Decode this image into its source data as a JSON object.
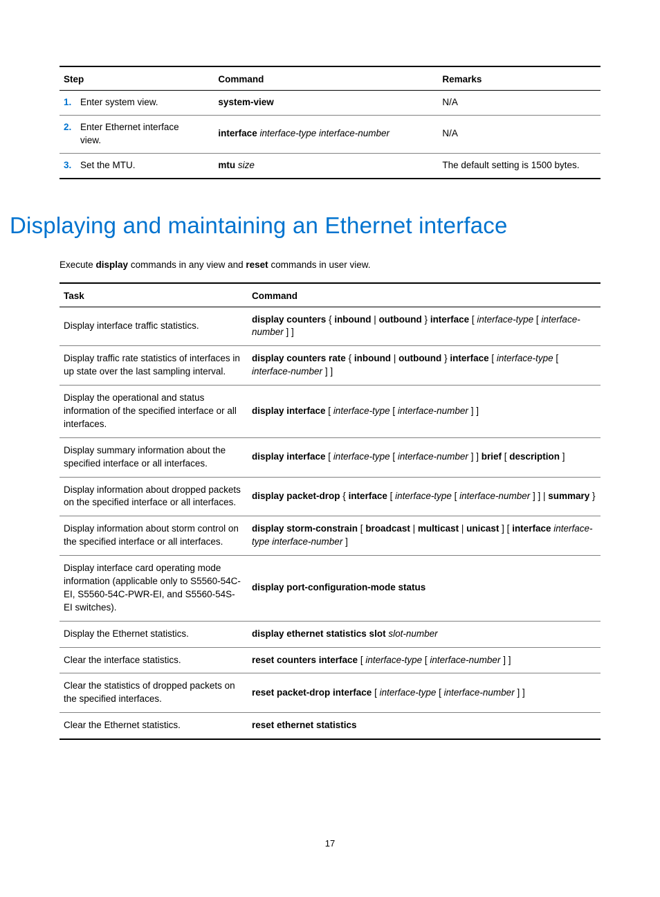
{
  "steps_table": {
    "headers": {
      "step": "Step",
      "command": "Command",
      "remarks": "Remarks"
    },
    "rows": [
      {
        "num": "1.",
        "step": "Enter system view.",
        "cmd_bold": "system-view",
        "cmd_italic": "",
        "remarks": "N/A"
      },
      {
        "num": "2.",
        "step": "Enter Ethernet interface view.",
        "cmd_bold": "interface",
        "cmd_italic": " interface-type interface-number",
        "remarks": "N/A"
      },
      {
        "num": "3.",
        "step": "Set the MTU.",
        "cmd_bold": "mtu",
        "cmd_italic": " size",
        "remarks": "The default setting is 1500 bytes."
      }
    ]
  },
  "heading": "Displaying and maintaining an Ethernet interface",
  "intro": {
    "p1": "Execute ",
    "b1": "display",
    "p2": " commands in any view and ",
    "b2": "reset",
    "p3": " commands in user view."
  },
  "tasks_table": {
    "headers": {
      "task": "Task",
      "command": "Command"
    },
    "rows": [
      {
        "task": "Display interface traffic statistics.",
        "cmd": [
          {
            "b": "display counters"
          },
          {
            "t": " { "
          },
          {
            "b": "inbound"
          },
          {
            "t": " | "
          },
          {
            "b": "outbound"
          },
          {
            "t": " } "
          },
          {
            "b": "interface"
          },
          {
            "t": " [ "
          },
          {
            "i": "interface-type"
          },
          {
            "t": " [ "
          },
          {
            "i": "interface-number"
          },
          {
            "t": " ] ]"
          }
        ]
      },
      {
        "task": "Display traffic rate statistics of interfaces in up state over the last sampling interval.",
        "cmd": [
          {
            "b": "display counters rate"
          },
          {
            "t": " { "
          },
          {
            "b": "inbound"
          },
          {
            "t": " | "
          },
          {
            "b": "outbound"
          },
          {
            "t": " } "
          },
          {
            "b": "interface"
          },
          {
            "t": " [ "
          },
          {
            "i": "interface-type"
          },
          {
            "t": " [ "
          },
          {
            "i": "interface-number"
          },
          {
            "t": " ] ]"
          }
        ]
      },
      {
        "task": "Display the operational and status information of the specified interface or all interfaces.",
        "cmd": [
          {
            "b": "display interface"
          },
          {
            "t": " [ "
          },
          {
            "i": "interface-type"
          },
          {
            "t": " [ "
          },
          {
            "i": "interface-number"
          },
          {
            "t": " ] ]"
          }
        ]
      },
      {
        "task": "Display summary information about the specified interface or all interfaces.",
        "cmd": [
          {
            "b": "display interface"
          },
          {
            "t": " [ "
          },
          {
            "i": "interface-type"
          },
          {
            "t": " [ "
          },
          {
            "i": "interface-number"
          },
          {
            "t": " ] ] "
          },
          {
            "b": "brief"
          },
          {
            "t": " [ "
          },
          {
            "b": "description"
          },
          {
            "t": " ]"
          }
        ]
      },
      {
        "task": "Display information about dropped packets on the specified interface or all interfaces.",
        "cmd": [
          {
            "b": "display packet-drop"
          },
          {
            "t": " { "
          },
          {
            "b": "interface"
          },
          {
            "t": " [ "
          },
          {
            "i": "interface-type"
          },
          {
            "t": " [ "
          },
          {
            "i": "interface-number"
          },
          {
            "t": " ] ] | "
          },
          {
            "b": "summary"
          },
          {
            "t": " }"
          }
        ]
      },
      {
        "task": "Display information about storm control on the specified interface or all interfaces.",
        "cmd": [
          {
            "b": "display storm-constrain"
          },
          {
            "t": " [ "
          },
          {
            "b": "broadcast"
          },
          {
            "t": " | "
          },
          {
            "b": "multicast"
          },
          {
            "t": " | "
          },
          {
            "b": "unicast"
          },
          {
            "t": " ] [ "
          },
          {
            "b": "interface"
          },
          {
            "t": " "
          },
          {
            "i": "interface-type interface-number"
          },
          {
            "t": " ]"
          }
        ]
      },
      {
        "task": "Display interface card operating mode information (applicable only to S5560-54C-EI, S5560-54C-PWR-EI, and S5560-54S-EI switches).",
        "cmd": [
          {
            "b": "display port-configuration-mode status"
          }
        ]
      },
      {
        "task": "Display the Ethernet statistics.",
        "cmd": [
          {
            "b": "display ethernet statistics slot"
          },
          {
            "t": " "
          },
          {
            "i": "slot-number"
          }
        ]
      },
      {
        "task": "Clear the interface statistics.",
        "cmd": [
          {
            "b": "reset counters interface"
          },
          {
            "t": " [ "
          },
          {
            "i": "interface-type"
          },
          {
            "t": " [ "
          },
          {
            "i": "interface-number"
          },
          {
            "t": " ] ]"
          }
        ]
      },
      {
        "task": "Clear the statistics of dropped packets on the specified interfaces.",
        "cmd": [
          {
            "b": "reset packet-drop interface"
          },
          {
            "t": " [ "
          },
          {
            "i": "interface-type"
          },
          {
            "t": " [ "
          },
          {
            "i": "interface-number"
          },
          {
            "t": " ] ]"
          }
        ]
      },
      {
        "task": "Clear the Ethernet statistics.",
        "cmd": [
          {
            "b": "reset ethernet statistics"
          }
        ]
      }
    ]
  },
  "page_number": "17"
}
